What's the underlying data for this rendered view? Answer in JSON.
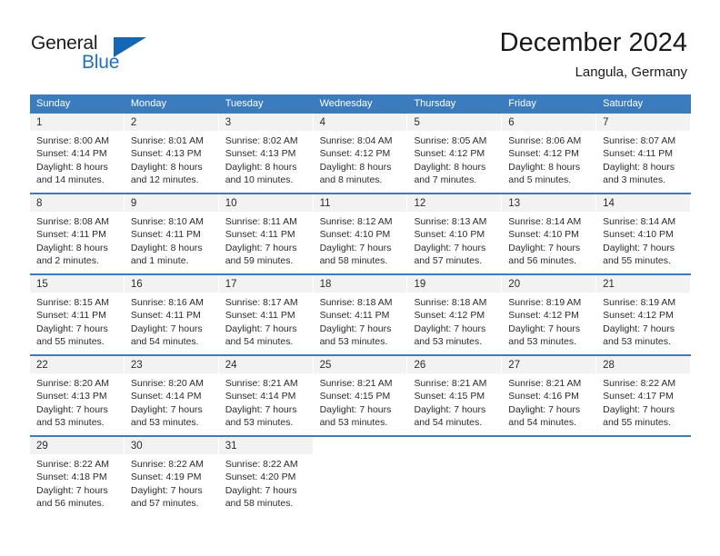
{
  "logo": {
    "word1": "General",
    "word2": "Blue",
    "mark": "triangle-flag"
  },
  "header": {
    "title": "December 2024",
    "subtitle": "Langula, Germany"
  },
  "weekdays": [
    "Sunday",
    "Monday",
    "Tuesday",
    "Wednesday",
    "Thursday",
    "Friday",
    "Saturday"
  ],
  "colors": {
    "header_blue": "#3a7cbe",
    "day_band_gray": "#f2f2f2",
    "logo_blue": "#1667b3",
    "text": "#2b2b2b"
  },
  "weeks": [
    {
      "days": [
        {
          "num": "1",
          "l1": "Sunrise: 8:00 AM",
          "l2": "Sunset: 4:14 PM",
          "l3": "Daylight: 8 hours",
          "l4": "and 14 minutes."
        },
        {
          "num": "2",
          "l1": "Sunrise: 8:01 AM",
          "l2": "Sunset: 4:13 PM",
          "l3": "Daylight: 8 hours",
          "l4": "and 12 minutes."
        },
        {
          "num": "3",
          "l1": "Sunrise: 8:02 AM",
          "l2": "Sunset: 4:13 PM",
          "l3": "Daylight: 8 hours",
          "l4": "and 10 minutes."
        },
        {
          "num": "4",
          "l1": "Sunrise: 8:04 AM",
          "l2": "Sunset: 4:12 PM",
          "l3": "Daylight: 8 hours",
          "l4": "and 8 minutes."
        },
        {
          "num": "5",
          "l1": "Sunrise: 8:05 AM",
          "l2": "Sunset: 4:12 PM",
          "l3": "Daylight: 8 hours",
          "l4": "and 7 minutes."
        },
        {
          "num": "6",
          "l1": "Sunrise: 8:06 AM",
          "l2": "Sunset: 4:12 PM",
          "l3": "Daylight: 8 hours",
          "l4": "and 5 minutes."
        },
        {
          "num": "7",
          "l1": "Sunrise: 8:07 AM",
          "l2": "Sunset: 4:11 PM",
          "l3": "Daylight: 8 hours",
          "l4": "and 3 minutes."
        }
      ]
    },
    {
      "days": [
        {
          "num": "8",
          "l1": "Sunrise: 8:08 AM",
          "l2": "Sunset: 4:11 PM",
          "l3": "Daylight: 8 hours",
          "l4": "and 2 minutes."
        },
        {
          "num": "9",
          "l1": "Sunrise: 8:10 AM",
          "l2": "Sunset: 4:11 PM",
          "l3": "Daylight: 8 hours",
          "l4": "and 1 minute."
        },
        {
          "num": "10",
          "l1": "Sunrise: 8:11 AM",
          "l2": "Sunset: 4:11 PM",
          "l3": "Daylight: 7 hours",
          "l4": "and 59 minutes."
        },
        {
          "num": "11",
          "l1": "Sunrise: 8:12 AM",
          "l2": "Sunset: 4:10 PM",
          "l3": "Daylight: 7 hours",
          "l4": "and 58 minutes."
        },
        {
          "num": "12",
          "l1": "Sunrise: 8:13 AM",
          "l2": "Sunset: 4:10 PM",
          "l3": "Daylight: 7 hours",
          "l4": "and 57 minutes."
        },
        {
          "num": "13",
          "l1": "Sunrise: 8:14 AM",
          "l2": "Sunset: 4:10 PM",
          "l3": "Daylight: 7 hours",
          "l4": "and 56 minutes."
        },
        {
          "num": "14",
          "l1": "Sunrise: 8:14 AM",
          "l2": "Sunset: 4:10 PM",
          "l3": "Daylight: 7 hours",
          "l4": "and 55 minutes."
        }
      ]
    },
    {
      "days": [
        {
          "num": "15",
          "l1": "Sunrise: 8:15 AM",
          "l2": "Sunset: 4:11 PM",
          "l3": "Daylight: 7 hours",
          "l4": "and 55 minutes."
        },
        {
          "num": "16",
          "l1": "Sunrise: 8:16 AM",
          "l2": "Sunset: 4:11 PM",
          "l3": "Daylight: 7 hours",
          "l4": "and 54 minutes."
        },
        {
          "num": "17",
          "l1": "Sunrise: 8:17 AM",
          "l2": "Sunset: 4:11 PM",
          "l3": "Daylight: 7 hours",
          "l4": "and 54 minutes."
        },
        {
          "num": "18",
          "l1": "Sunrise: 8:18 AM",
          "l2": "Sunset: 4:11 PM",
          "l3": "Daylight: 7 hours",
          "l4": "and 53 minutes."
        },
        {
          "num": "19",
          "l1": "Sunrise: 8:18 AM",
          "l2": "Sunset: 4:12 PM",
          "l3": "Daylight: 7 hours",
          "l4": "and 53 minutes."
        },
        {
          "num": "20",
          "l1": "Sunrise: 8:19 AM",
          "l2": "Sunset: 4:12 PM",
          "l3": "Daylight: 7 hours",
          "l4": "and 53 minutes."
        },
        {
          "num": "21",
          "l1": "Sunrise: 8:19 AM",
          "l2": "Sunset: 4:12 PM",
          "l3": "Daylight: 7 hours",
          "l4": "and 53 minutes."
        }
      ]
    },
    {
      "days": [
        {
          "num": "22",
          "l1": "Sunrise: 8:20 AM",
          "l2": "Sunset: 4:13 PM",
          "l3": "Daylight: 7 hours",
          "l4": "and 53 minutes."
        },
        {
          "num": "23",
          "l1": "Sunrise: 8:20 AM",
          "l2": "Sunset: 4:14 PM",
          "l3": "Daylight: 7 hours",
          "l4": "and 53 minutes."
        },
        {
          "num": "24",
          "l1": "Sunrise: 8:21 AM",
          "l2": "Sunset: 4:14 PM",
          "l3": "Daylight: 7 hours",
          "l4": "and 53 minutes."
        },
        {
          "num": "25",
          "l1": "Sunrise: 8:21 AM",
          "l2": "Sunset: 4:15 PM",
          "l3": "Daylight: 7 hours",
          "l4": "and 53 minutes."
        },
        {
          "num": "26",
          "l1": "Sunrise: 8:21 AM",
          "l2": "Sunset: 4:15 PM",
          "l3": "Daylight: 7 hours",
          "l4": "and 54 minutes."
        },
        {
          "num": "27",
          "l1": "Sunrise: 8:21 AM",
          "l2": "Sunset: 4:16 PM",
          "l3": "Daylight: 7 hours",
          "l4": "and 54 minutes."
        },
        {
          "num": "28",
          "l1": "Sunrise: 8:22 AM",
          "l2": "Sunset: 4:17 PM",
          "l3": "Daylight: 7 hours",
          "l4": "and 55 minutes."
        }
      ]
    },
    {
      "days": [
        {
          "num": "29",
          "l1": "Sunrise: 8:22 AM",
          "l2": "Sunset: 4:18 PM",
          "l3": "Daylight: 7 hours",
          "l4": "and 56 minutes."
        },
        {
          "num": "30",
          "l1": "Sunrise: 8:22 AM",
          "l2": "Sunset: 4:19 PM",
          "l3": "Daylight: 7 hours",
          "l4": "and 57 minutes."
        },
        {
          "num": "31",
          "l1": "Sunrise: 8:22 AM",
          "l2": "Sunset: 4:20 PM",
          "l3": "Daylight: 7 hours",
          "l4": "and 58 minutes."
        },
        {
          "num": "",
          "l1": "",
          "l2": "",
          "l3": "",
          "l4": ""
        },
        {
          "num": "",
          "l1": "",
          "l2": "",
          "l3": "",
          "l4": ""
        },
        {
          "num": "",
          "l1": "",
          "l2": "",
          "l3": "",
          "l4": ""
        },
        {
          "num": "",
          "l1": "",
          "l2": "",
          "l3": "",
          "l4": ""
        }
      ]
    }
  ]
}
